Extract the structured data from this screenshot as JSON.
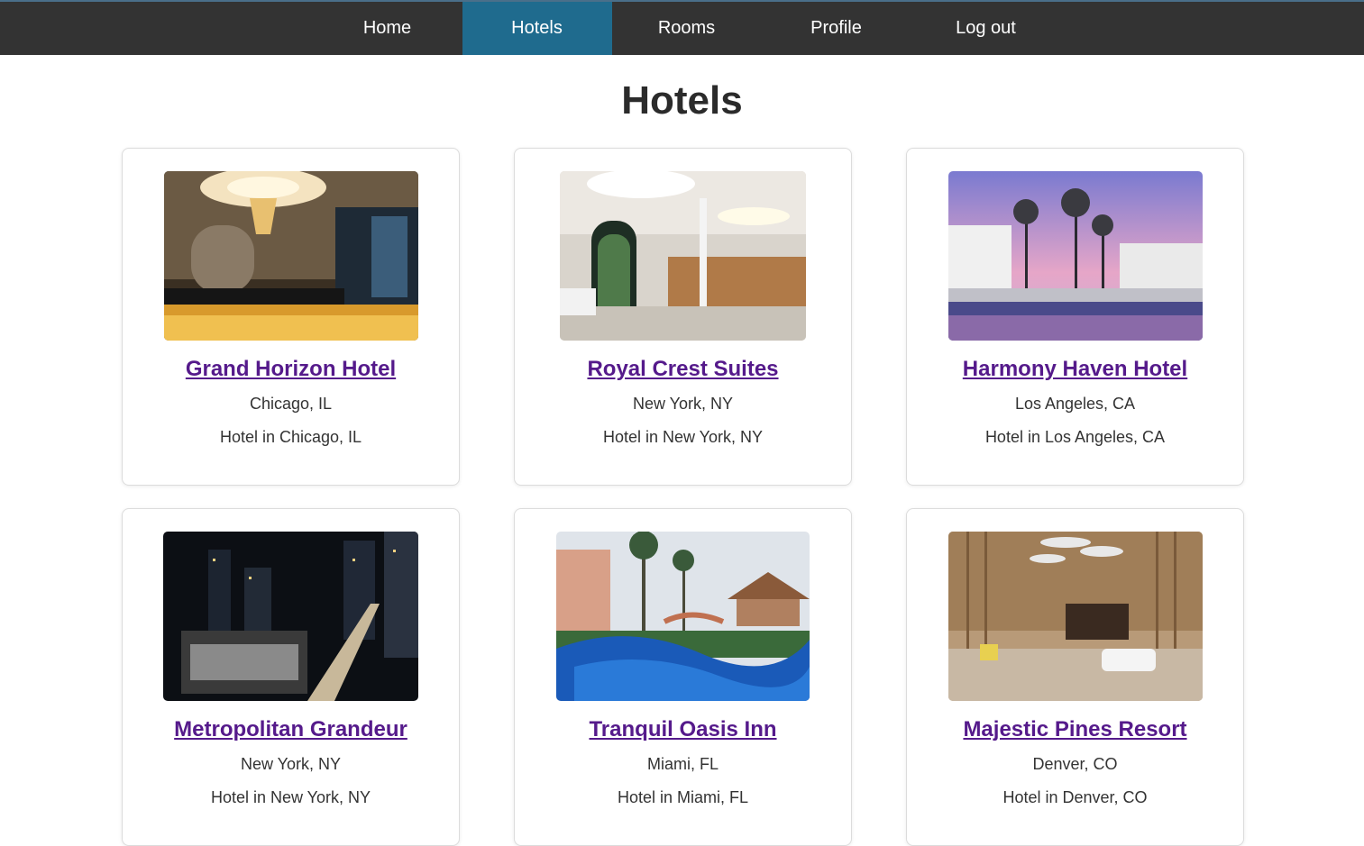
{
  "nav": {
    "items": [
      {
        "label": "Home"
      },
      {
        "label": "Hotels"
      },
      {
        "label": "Rooms"
      },
      {
        "label": "Profile"
      },
      {
        "label": "Log out"
      }
    ],
    "active_color": "#1f6b8e",
    "bar_color": "#333333"
  },
  "page": {
    "title": "Hotels"
  },
  "hotels": [
    {
      "name": "Grand Horizon Hotel",
      "location": "Chicago, IL",
      "description": "Hotel in Chicago, IL",
      "image": "hotel-lobby-chandelier"
    },
    {
      "name": "Royal Crest Suites",
      "location": "New York, NY",
      "description": "Hotel in New York, NY",
      "image": "hotel-lobby-aquarium"
    },
    {
      "name": "Harmony Haven Hotel",
      "location": "Los Angeles, CA",
      "description": "Hotel in Los Angeles, CA",
      "image": "pool-palms-sunset"
    },
    {
      "name": "Metropolitan Grandeur",
      "location": "New York, NY",
      "description": "Hotel in New York, NY",
      "image": "city-skyline-night"
    },
    {
      "name": "Tranquil Oasis Inn",
      "location": "Miami, FL",
      "description": "Hotel in Miami, FL",
      "image": "resort-pool-palms"
    },
    {
      "name": "Majestic Pines Resort",
      "location": "Denver, CO",
      "description": "Hotel in Denver, CO",
      "image": "modern-wood-lobby"
    }
  ]
}
